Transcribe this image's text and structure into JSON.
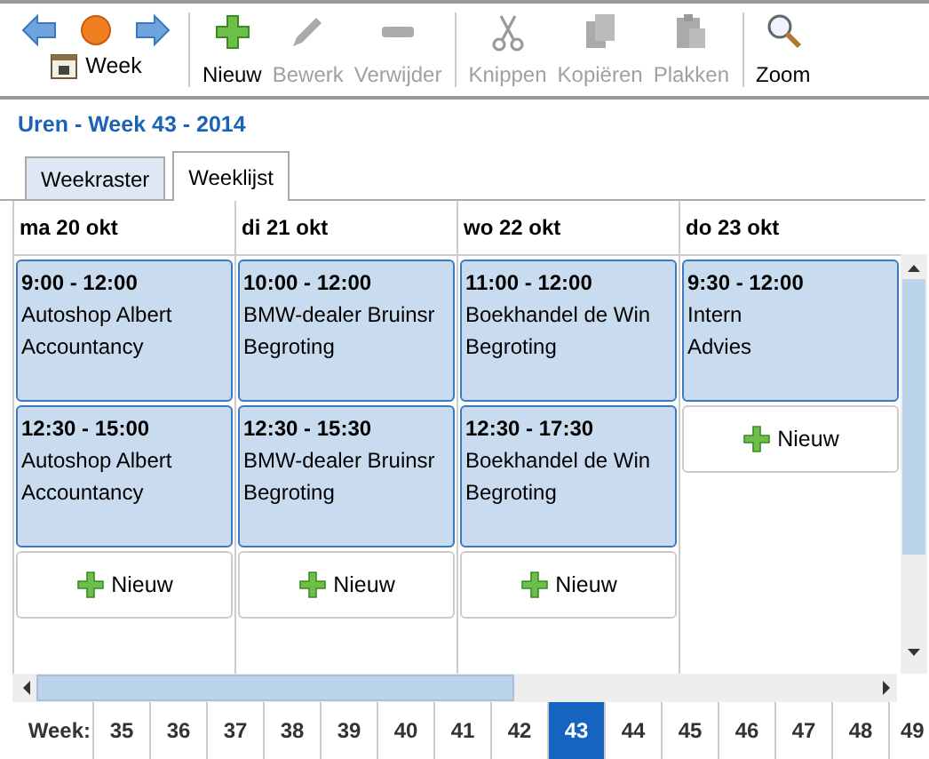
{
  "toolbar": {
    "nav": [
      {
        "kind": "back"
      },
      {
        "kind": "home"
      },
      {
        "kind": "forward"
      }
    ],
    "view_button": {
      "label": "Week"
    },
    "groups": [
      [
        {
          "kind": "add",
          "label": "Nieuw",
          "disabled": false
        },
        {
          "kind": "edit",
          "label": "Bewerk",
          "disabled": true
        },
        {
          "kind": "remove",
          "label": "Verwijder",
          "disabled": true
        }
      ],
      [
        {
          "kind": "cut",
          "label": "Knippen",
          "disabled": true
        },
        {
          "kind": "copy",
          "label": "Kopiëren",
          "disabled": true
        },
        {
          "kind": "paste",
          "label": "Plakken",
          "disabled": true
        }
      ],
      [
        {
          "kind": "zoom",
          "label": "Zoom",
          "disabled": false
        }
      ]
    ]
  },
  "title": "Uren - Week 43 - 2014",
  "tabs": [
    {
      "label": "Weekraster",
      "selected": false
    },
    {
      "label": "Weeklijst",
      "selected": true
    }
  ],
  "days": [
    {
      "header": "ma 20 okt",
      "new_label": "Nieuw",
      "entries": [
        {
          "time": "9:00 - 12:00",
          "client": "Autoshop Albert",
          "activity": "Accountancy"
        },
        {
          "time": "12:30 - 15:00",
          "client": "Autoshop Albert",
          "activity": "Accountancy"
        }
      ]
    },
    {
      "header": "di 21 okt",
      "new_label": "Nieuw",
      "entries": [
        {
          "time": "10:00 - 12:00",
          "client": "BMW-dealer Bruinsr",
          "activity": "Begroting"
        },
        {
          "time": "12:30 - 15:30",
          "client": "BMW-dealer Bruinsr",
          "activity": "Begroting"
        }
      ]
    },
    {
      "header": "wo 22 okt",
      "new_label": "Nieuw",
      "entries": [
        {
          "time": "11:00 - 12:00",
          "client": "Boekhandel de Win",
          "activity": "Begroting"
        },
        {
          "time": "12:30 - 17:30",
          "client": "Boekhandel de Win",
          "activity": "Begroting"
        }
      ]
    },
    {
      "header": "do 23 okt",
      "new_label": "Nieuw",
      "entries": [
        {
          "time": "9:30 - 12:00",
          "client": "Intern",
          "activity": "Advies"
        }
      ]
    }
  ],
  "weeks": {
    "label": "Week:",
    "items": [
      {
        "label": "35",
        "selected": false
      },
      {
        "label": "36",
        "selected": false
      },
      {
        "label": "37",
        "selected": false
      },
      {
        "label": "38",
        "selected": false
      },
      {
        "label": "39",
        "selected": false
      },
      {
        "label": "40",
        "selected": false
      },
      {
        "label": "41",
        "selected": false
      },
      {
        "label": "42",
        "selected": false
      },
      {
        "label": "43",
        "selected": true
      },
      {
        "label": "44",
        "selected": false
      },
      {
        "label": "45",
        "selected": false
      },
      {
        "label": "46",
        "selected": false
      },
      {
        "label": "47",
        "selected": false
      },
      {
        "label": "48",
        "selected": false
      },
      {
        "label": "49",
        "selected": false
      }
    ]
  }
}
